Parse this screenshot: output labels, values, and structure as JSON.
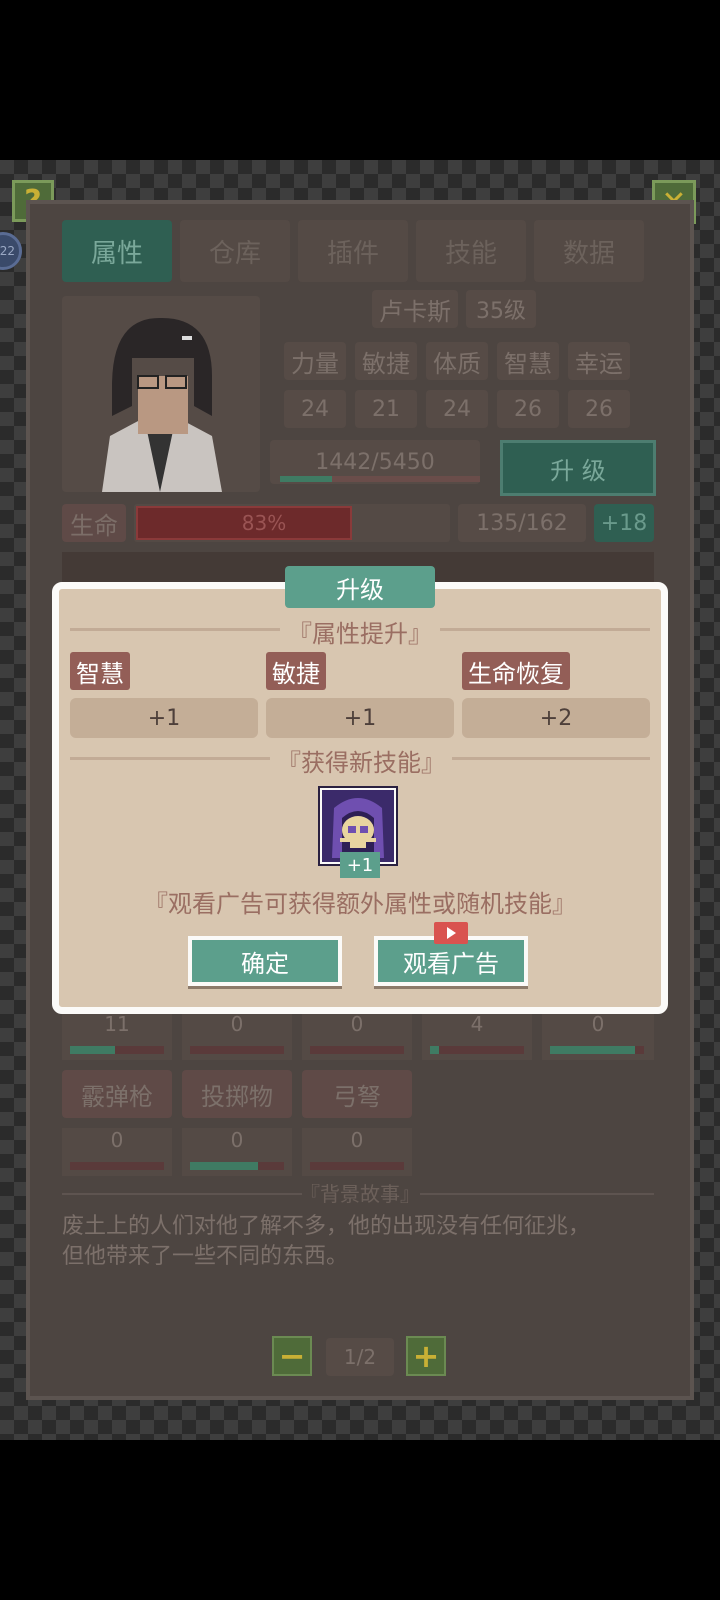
{
  "header": {
    "help_label": "?",
    "close_label": "✕",
    "side_badge": "22"
  },
  "tabs": [
    "属性",
    "仓库",
    "插件",
    "技能",
    "数据"
  ],
  "character": {
    "name": "卢卡斯",
    "level": "35级",
    "stat_names": [
      "力量",
      "敏捷",
      "体质",
      "智慧",
      "幸运"
    ],
    "stat_values": [
      "24",
      "21",
      "24",
      "26",
      "26"
    ],
    "exp_text": "1442/5450",
    "exp_progress": 0.26,
    "upgrade_label": "升 级",
    "hp_label": "生命",
    "hp_percent": "83%",
    "hp_progress": 0.83,
    "hp_text": "135/162",
    "hp_regen": "+18"
  },
  "weapons_row1_values": [
    "11",
    "0",
    "0",
    "4",
    "0"
  ],
  "weapons_row1_progress": [
    0.48,
    0,
    0,
    0.1,
    0.9
  ],
  "weapons_row2": {
    "names": [
      "霰弹枪",
      "投掷物",
      "弓弩"
    ],
    "values": [
      "0",
      "0",
      "0"
    ],
    "progress": [
      0,
      0.72,
      0
    ]
  },
  "backstory": {
    "title": "『背景故事』",
    "text_line1": "废土上的人们对他了解不多，他的出现没有任何征兆，",
    "text_line2": "但他带来了一些不同的东西。"
  },
  "pager": {
    "minus": "−",
    "plus": "+",
    "page": "1/2"
  },
  "dialog": {
    "title": "升级",
    "attr_section": "『属性提升』",
    "stats": [
      {
        "name": "智慧",
        "value": "+1"
      },
      {
        "name": "敏捷",
        "value": "+1"
      },
      {
        "name": "生命恢复",
        "value": "+2"
      }
    ],
    "skill_section": "『获得新技能』",
    "skill_badge": "+1",
    "ad_hint": "『观看广告可获得额外属性或随机技能』",
    "confirm_label": "确定",
    "watch_ad_label": "观看广告"
  },
  "colors": {
    "accent": "#5c9f8c",
    "dialog_bg": "#d8c6b0",
    "tag": "#935e57"
  }
}
